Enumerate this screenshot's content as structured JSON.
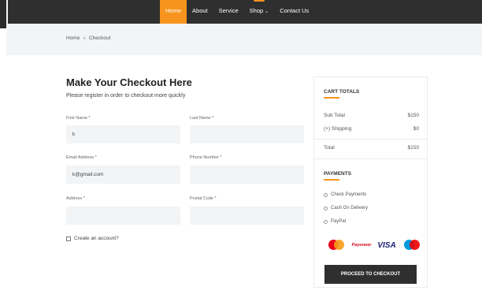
{
  "nav": {
    "items": [
      {
        "label": "Home",
        "active": true
      },
      {
        "label": "About",
        "active": false
      },
      {
        "label": "Service",
        "active": false
      },
      {
        "label": "Shop",
        "active": false,
        "dropdown": true
      },
      {
        "label": "Contact Us",
        "active": false
      }
    ]
  },
  "breadcrumb": {
    "home": "Home",
    "separator": "»",
    "current": "Checkout"
  },
  "form": {
    "title": "Make Your Checkout Here",
    "subtitle": "Please register in order to checkout more quickly",
    "first_name_label": "First Name *",
    "first_name_value": "k",
    "last_name_label": "Last Name *",
    "last_name_value": "",
    "email_label": "Email Address *",
    "email_value": "k@gmail.com",
    "phone_label": "Phone Number *",
    "phone_value": "",
    "address_label": "Address *",
    "address_value": "",
    "postal_label": "Postal Code *",
    "postal_value": "",
    "create_account_label": "Create an account?"
  },
  "cart": {
    "heading": "CART TOTALS",
    "subtotal_label": "Sub Total",
    "subtotal_value": "$150",
    "shipping_label": "(+) Shipping",
    "shipping_value": "$0",
    "total_label": "Total",
    "total_value": "$150"
  },
  "payments": {
    "heading": "PAYMENTS",
    "options": [
      "Check Payments",
      "Cash On Delivery",
      "PayPal"
    ],
    "logos": [
      "mastercard-logo",
      "payoneer-logo",
      "visa-logo",
      "maestro-logo"
    ],
    "payoneer_text": "Payoneer",
    "visa_text": "VISA"
  },
  "checkout_button": "PROCEED TO CHECKOUT",
  "colors": {
    "accent": "#f7941d",
    "dark": "#2f2f2f",
    "field_bg": "#f2f4f6"
  }
}
